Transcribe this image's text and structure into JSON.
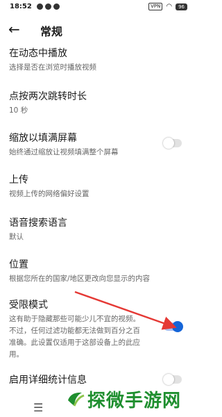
{
  "status_bar": {
    "time": "18:52",
    "vpn_label": "VPN",
    "battery": "96"
  },
  "header": {
    "back_icon": "arrow-left-icon",
    "title": "常规"
  },
  "settings": [
    {
      "title": "在动态中播放",
      "subtitle": "选择是否在浏览时播放视频"
    },
    {
      "title": "点按两次跳转时长",
      "subtitle": "10 秒"
    },
    {
      "title": "缩放以填满屏幕",
      "subtitle": "始终通过缩放让视频填满整个屏幕",
      "toggle": false
    },
    {
      "title": "上传",
      "subtitle": "视频上传的网络偏好设置"
    },
    {
      "title": "语音搜索语言",
      "subtitle": "默认"
    },
    {
      "title": "位置",
      "subtitle": "根据您所在的国家/地区更改向您显示的内容"
    },
    {
      "title": "受限模式",
      "subtitle": "这有助于隐藏那些可能少儿不宜的视频。不过，任何过滤功能都无法做到百分之百准确。此设置仅适用于这部设备上的此应用。",
      "toggle": true
    },
    {
      "title": "启用详细统计信息",
      "toggle": false
    }
  ],
  "colors": {
    "toggle_on": "#1565d8",
    "arrow": "#e53935",
    "watermark": "#1f8f2f"
  },
  "watermark": {
    "text": "探微手游网"
  },
  "navbar": {
    "menu_icon": "menu-icon"
  }
}
